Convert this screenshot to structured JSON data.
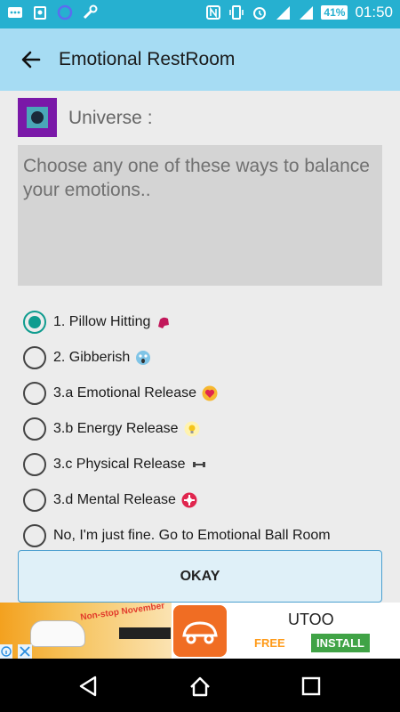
{
  "status_bar": {
    "time": "01:50",
    "battery": "41%",
    "icons": [
      "messages-icon",
      "store-icon",
      "sync-icon",
      "wrench-icon",
      "nfc-icon",
      "vibrate-icon",
      "alarm-icon",
      "signal-1-icon",
      "signal-2-icon"
    ]
  },
  "app_bar": {
    "title": "Emotional RestRoom",
    "back_icon": "arrow-back-icon"
  },
  "universe": {
    "label": "Universe :"
  },
  "message": {
    "text": "Choose any one of these ways to balance your emotions.."
  },
  "options": [
    {
      "label": "1. Pillow Hitting",
      "icon": "boxing-glove-icon",
      "checked": true
    },
    {
      "label": "2. Gibberish",
      "icon": "screaming-face-icon",
      "checked": false
    },
    {
      "label": "3.a Emotional Release",
      "icon": "heart-icon",
      "checked": false
    },
    {
      "label": "3.b Energy Release",
      "icon": "lightbulb-icon",
      "checked": false
    },
    {
      "label": "3.c Physical Release",
      "icon": "dumbbell-icon",
      "checked": false
    },
    {
      "label": "3.d Mental Release",
      "icon": "gear-icon",
      "checked": false
    },
    {
      "label": "No, I'm just fine. Go to Emotional Ball Room",
      "icon": "",
      "checked": false
    }
  ],
  "okay_button": {
    "label": "OKAY"
  },
  "ad": {
    "promo_text": "Non-stop November",
    "title": "UTOO",
    "free_label": "FREE",
    "install_label": "INSTALL"
  },
  "colors": {
    "status_bar": "#26b0d0",
    "app_bar": "#a6dcf3",
    "accent": "#0f9c8f"
  }
}
